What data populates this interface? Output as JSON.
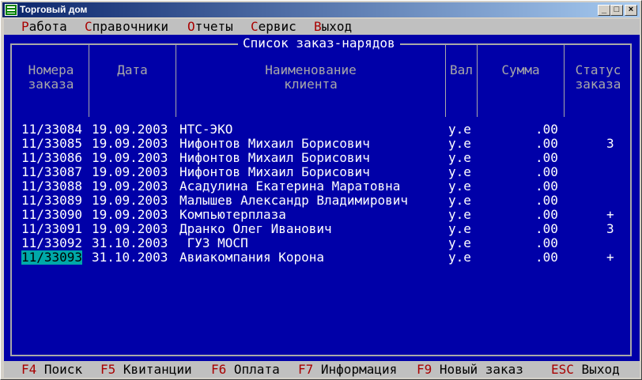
{
  "window": {
    "title": "Торговый дом",
    "icon": "console-app-icon",
    "controls": {
      "minimize": "_",
      "maximize": "□",
      "close": "×"
    }
  },
  "menu": [
    {
      "hotkey": "Р",
      "rest": "абота"
    },
    {
      "hotkey": "С",
      "rest": "правочники"
    },
    {
      "hotkey": "О",
      "rest": "тчеты"
    },
    {
      "hotkey": "С",
      "rest": "ервис"
    },
    {
      "hotkey": "В",
      "rest": "ыход"
    }
  ],
  "panel_title": "Список заказ-нарядов",
  "headers": {
    "order_no": [
      "Номера",
      "заказа"
    ],
    "date": [
      "Дата",
      ""
    ],
    "client": [
      "Наименование",
      "клиента"
    ],
    "currency": [
      "Вал",
      ""
    ],
    "sum": [
      "Сумма",
      ""
    ],
    "status": [
      "Статус",
      "заказа"
    ]
  },
  "rows": [
    {
      "no": "11/33084",
      "date": "19.09.2003",
      "client": "НТС-ЭКО",
      "cur": "у.е",
      "sum": ".00",
      "status": ""
    },
    {
      "no": "11/33085",
      "date": "19.09.2003",
      "client": "Нифонтов Михаил Борисович",
      "cur": "у.е",
      "sum": ".00",
      "status": "3"
    },
    {
      "no": "11/33086",
      "date": "19.09.2003",
      "client": "Нифонтов Михаил Борисович",
      "cur": "у.е",
      "sum": ".00",
      "status": ""
    },
    {
      "no": "11/33087",
      "date": "19.09.2003",
      "client": "Нифонтов Михаил Борисович",
      "cur": "у.е",
      "sum": ".00",
      "status": ""
    },
    {
      "no": "11/33088",
      "date": "19.09.2003",
      "client": "Асадулина Екатерина Маратовна",
      "cur": "у.е",
      "sum": ".00",
      "status": ""
    },
    {
      "no": "11/33089",
      "date": "19.09.2003",
      "client": "Малышев Александр Владимирович",
      "cur": "у.е",
      "sum": ".00",
      "status": ""
    },
    {
      "no": "11/33090",
      "date": "19.09.2003",
      "client": "Компьютерплаза",
      "cur": "у.е",
      "sum": ".00",
      "status": "+"
    },
    {
      "no": "11/33091",
      "date": "19.09.2003",
      "client": "Дранко Олег Иванович",
      "cur": "у.е",
      "sum": ".00",
      "status": "3"
    },
    {
      "no": "11/33092",
      "date": "31.10.2003",
      "client": " ГУЗ МОСП",
      "cur": "у.е",
      "sum": ".00",
      "status": ""
    },
    {
      "no": "11/33093",
      "date": "31.10.2003",
      "client": "Авиакомпания Корона",
      "cur": "у.е",
      "sum": ".00",
      "status": "+"
    }
  ],
  "selected_row": 9,
  "fkeys": [
    {
      "key": "F4",
      "label": "Поиск"
    },
    {
      "key": "F5",
      "label": "Квитанции"
    },
    {
      "key": "F6",
      "label": "Оплата"
    },
    {
      "key": "F7",
      "label": "Информация"
    },
    {
      "key": "F9",
      "label": "Новый заказ"
    },
    {
      "key": "ESC",
      "label": "Выход"
    }
  ],
  "colors": {
    "titlebar_start": "#0A246A",
    "titlebar_end": "#A6CAF0",
    "panel_background": "#0000A8",
    "menubar_background": "#C0C0C0",
    "hotkey": "#A80000",
    "selection": "#00A8A8",
    "frame_lines": "#A8A8A8"
  }
}
